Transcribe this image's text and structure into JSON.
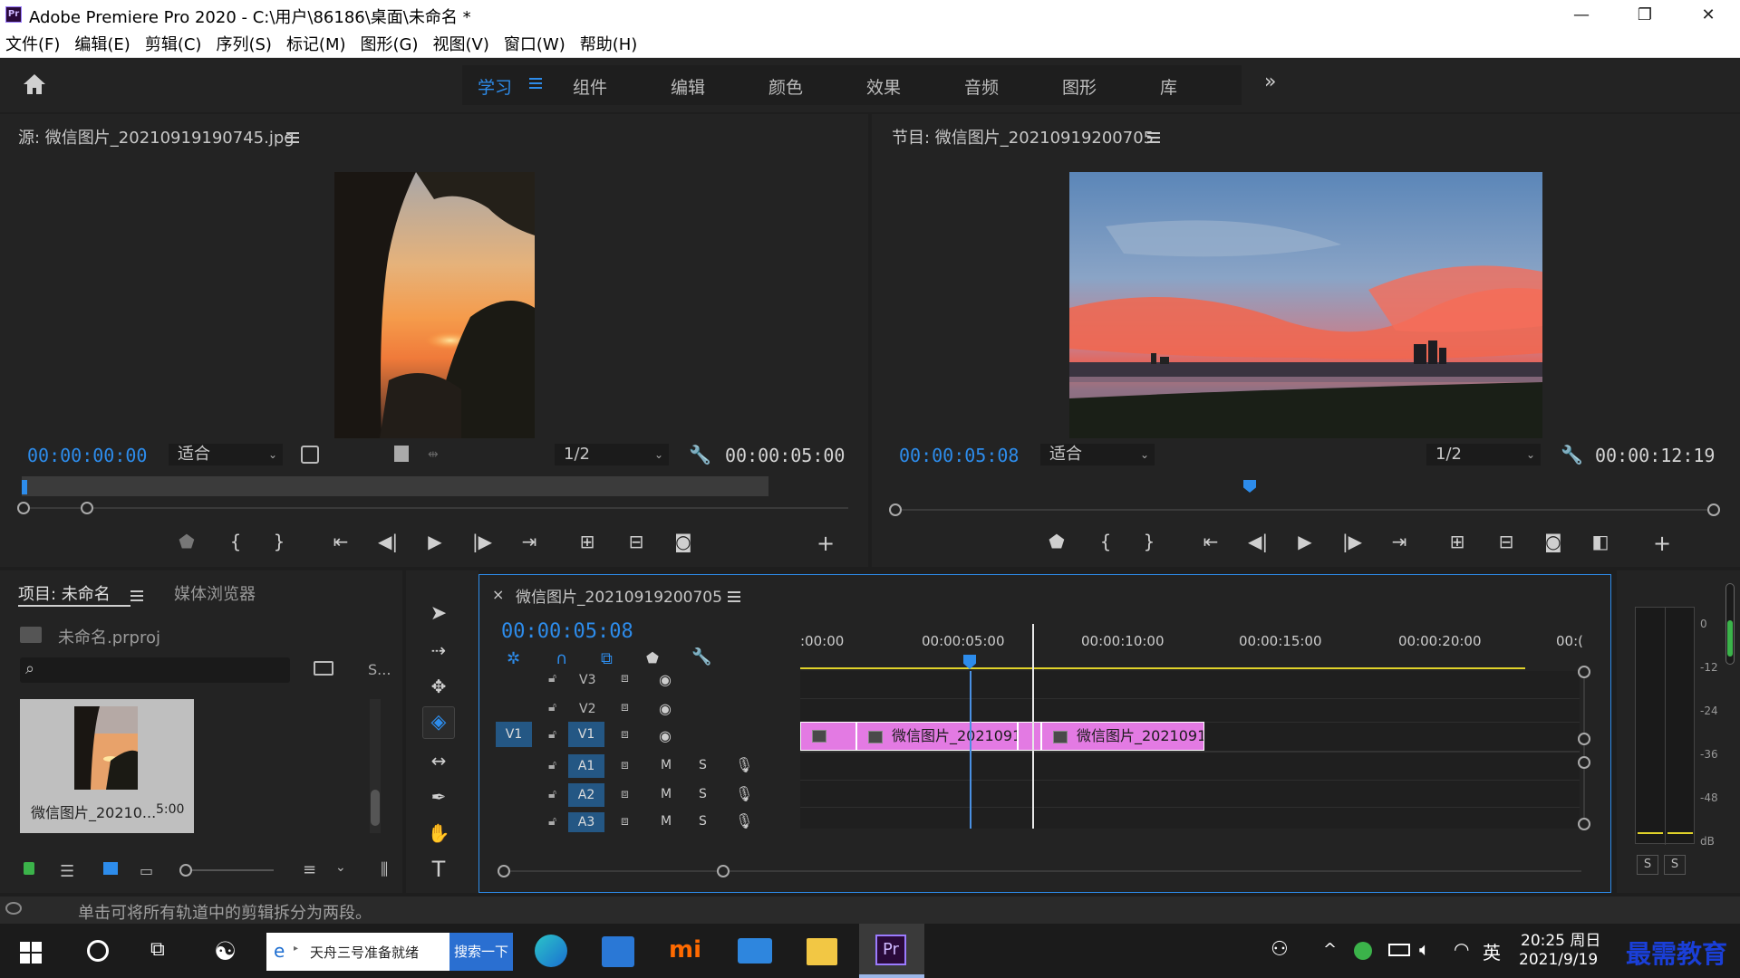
{
  "window": {
    "app_badge": "Pr",
    "title": "Adobe Premiere Pro 2020 - C:\\用户\\86186\\桌面\\未命名 *",
    "minimize": "—",
    "restore": "❐",
    "close": "✕"
  },
  "menu": [
    "文件(F)",
    "编辑(E)",
    "剪辑(C)",
    "序列(S)",
    "标记(M)",
    "图形(G)",
    "视图(V)",
    "窗口(W)",
    "帮助(H)"
  ],
  "workspaces": {
    "active": "学习",
    "tabs": [
      "组件",
      "编辑",
      "颜色",
      "效果",
      "音频",
      "图形",
      "库"
    ],
    "more": "»"
  },
  "source_monitor": {
    "title": "源: 微信图片_20210919190745.jpg",
    "timecode": "00:00:00:00",
    "fit": "适合",
    "resolution": "1/2",
    "duration": "00:00:05:00"
  },
  "program_monitor": {
    "title": "节目: 微信图片_20210919200705",
    "timecode": "00:00:05:08",
    "fit": "适合",
    "resolution": "1/2",
    "duration": "00:00:12:19"
  },
  "project_panel": {
    "tab_project": "项目: 未命名",
    "tab_media": "媒体浏览器",
    "file_name": "未命名.prproj",
    "truncated_label": "S...",
    "item_name": "微信图片_20210...",
    "item_duration": "5:00"
  },
  "timeline": {
    "sequence_name": "微信图片_20210919200705",
    "close": "×",
    "timecode": "00:00:05:08",
    "ruler": [
      ":00:00",
      "00:00:05:00",
      "00:00:10:00",
      "00:00:15:00",
      "00:00:20:00",
      "00:("
    ],
    "video_tracks": [
      "V3",
      "V2",
      "V1"
    ],
    "audio_tracks": [
      "A1",
      "A2",
      "A3"
    ],
    "source_patch": "V1",
    "mute": "M",
    "solo": "S",
    "clips": [
      {
        "label": ""
      },
      {
        "label": "微信图片_2021091"
      },
      {
        "label": ""
      },
      {
        "label": "微信图片_2021091"
      }
    ]
  },
  "audio_meter": {
    "scale": [
      "0",
      "-12",
      "-24",
      "-36",
      "-48",
      "dB"
    ],
    "solo_left": "S",
    "solo_right": "S"
  },
  "status_text": "单击可将所有轨道中的剪辑拆分为两段。",
  "taskbar": {
    "search_text": "天舟三号准备就绪",
    "search_button": "搜索一下",
    "language": "英",
    "time": "20:25 周日",
    "date": "2021/9/19",
    "watermark": "最需教育"
  },
  "colors": {
    "accent_blue": "#2d8ceb",
    "clip_pink": "#e37ae3",
    "playhead_blue": "#4a90e2",
    "work_area_yellow": "#e0d22a"
  }
}
